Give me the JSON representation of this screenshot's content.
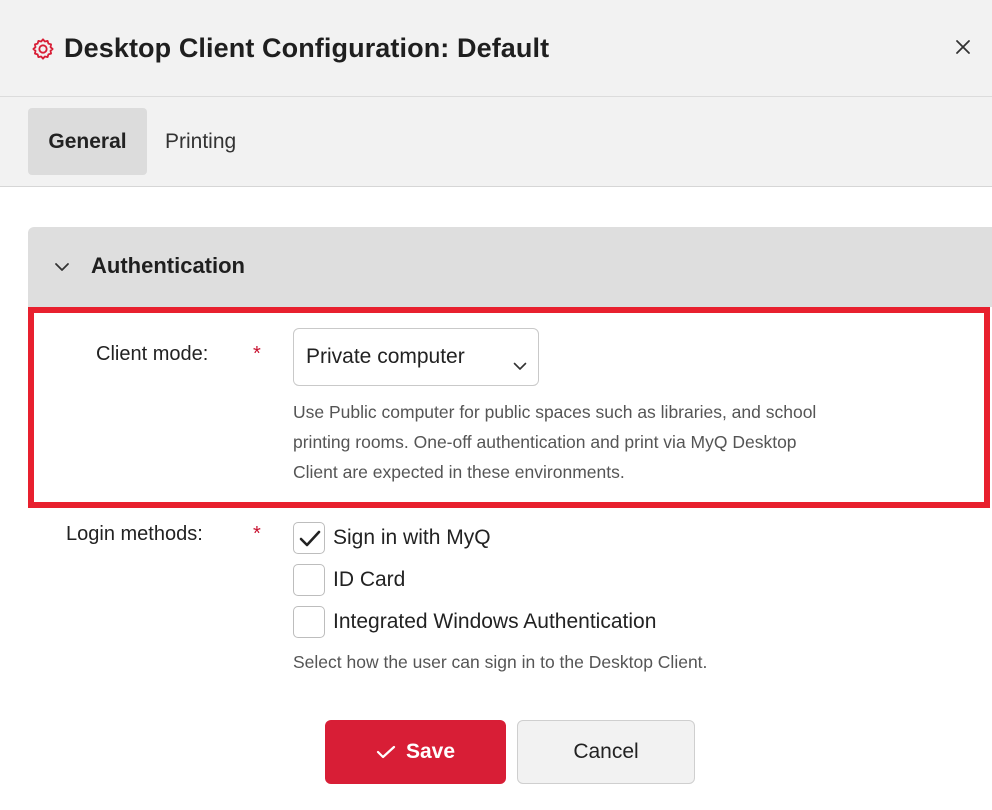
{
  "dialog": {
    "title": "Desktop Client Configuration: Default",
    "icon": "gear-icon",
    "close_icon": "close-icon",
    "accent_color": "#d81e36"
  },
  "tabs": [
    {
      "label": "General",
      "active": true
    },
    {
      "label": "Printing",
      "active": false
    }
  ],
  "section": {
    "title": "Authentication",
    "expanded": true
  },
  "client_mode": {
    "label": "Client mode:",
    "required_marker": "*",
    "value": "Private computer",
    "help_lines": [
      "Use Public computer for public spaces such as libraries, and school",
      "printing rooms. One-off authentication and print via MyQ Desktop",
      "Client are expected in these environments."
    ]
  },
  "login_methods": {
    "label": "Login methods:",
    "required_marker": "*",
    "options": [
      {
        "label": "Sign in with MyQ",
        "checked": true
      },
      {
        "label": "ID Card",
        "checked": false
      },
      {
        "label": "Integrated Windows Authentication",
        "checked": false
      }
    ],
    "help": "Select how the user can sign in to the Desktop Client."
  },
  "actions": {
    "save_label": "Save",
    "cancel_label": "Cancel"
  }
}
